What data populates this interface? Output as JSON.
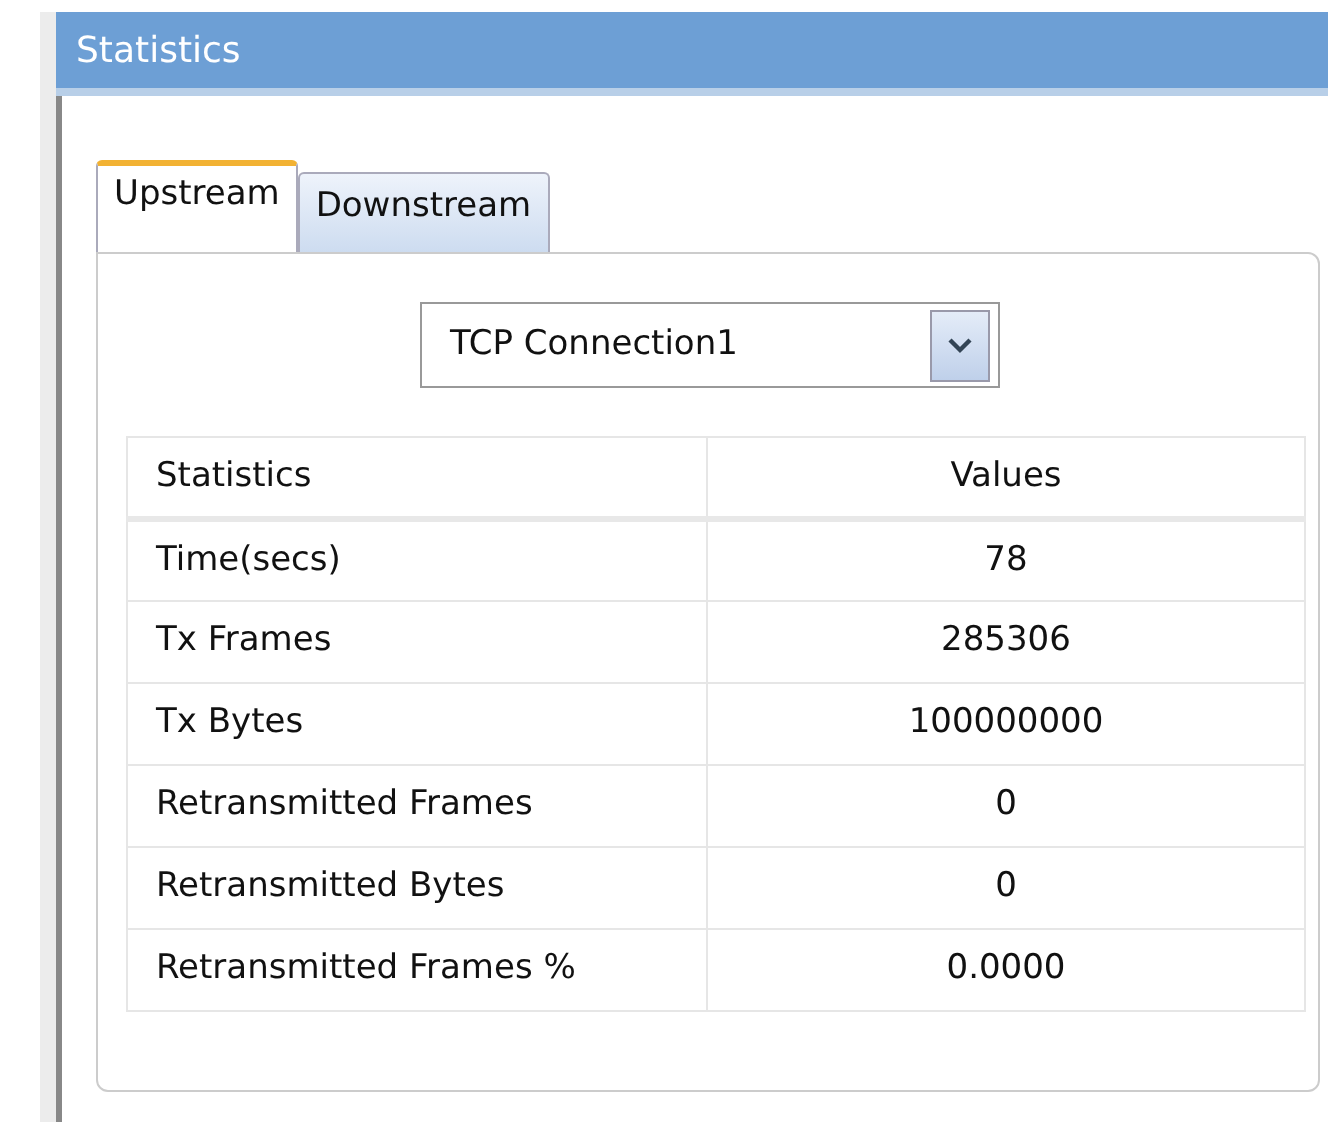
{
  "window": {
    "title": "Statistics"
  },
  "tabs": [
    {
      "label": "Upstream",
      "selected": true
    },
    {
      "label": "Downstream",
      "selected": false
    }
  ],
  "connection_select": {
    "value": "TCP Connection1"
  },
  "table": {
    "columns": [
      "Statistics",
      "Values"
    ],
    "rows": [
      [
        "Time(secs)",
        "78"
      ],
      [
        "Tx Frames",
        "285306"
      ],
      [
        "Tx Bytes",
        "100000000"
      ],
      [
        "Retransmitted Frames",
        "0"
      ],
      [
        "Retransmitted Bytes",
        "0"
      ],
      [
        "Retransmitted Frames %",
        "0.0000"
      ]
    ]
  }
}
